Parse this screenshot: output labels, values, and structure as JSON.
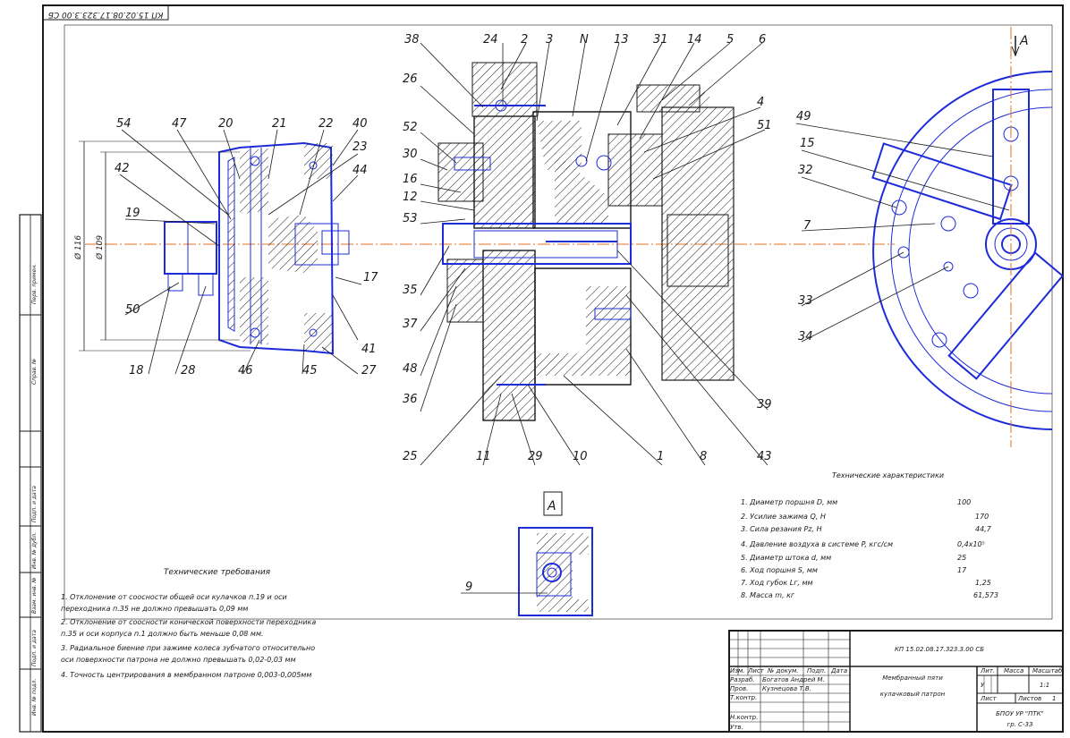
{
  "stamp_code": "КП 15.02.08.17.323.3.00 СБ",
  "side_labels": [
    "Инв. № подл.",
    "Подп. и дата",
    "Взам. инв. №",
    "Инв. № дубл.",
    "Подп. и дата",
    "Справ. №",
    "Перв. примен."
  ],
  "dimensions": {
    "d1": "Ø 116",
    "d2": "Ø 109"
  },
  "view_marker": "A",
  "section_view_label": "A",
  "callouts": {
    "c54": "54",
    "c47": "47",
    "c20": "20",
    "c21": "21",
    "c22": "22",
    "c40": "40",
    "c42": "42",
    "c23": "23",
    "c44": "44",
    "c19": "19",
    "c17": "17",
    "c50": "50",
    "c41": "41",
    "c18": "18",
    "c28": "28",
    "c46": "46",
    "c45": "45",
    "c27": "27",
    "c38": "38",
    "c24": "24",
    "c2": "2",
    "c3": "3",
    "cN": "N",
    "c13": "13",
    "c31": "31",
    "c14": "14",
    "c5": "5",
    "c6": "6",
    "c26": "26",
    "c4": "4",
    "c52": "52",
    "c51": "51",
    "c30": "30",
    "c16": "16",
    "c12": "12",
    "c53": "53",
    "c35": "35",
    "c37": "37",
    "c48": "48",
    "c36": "36",
    "c25": "25",
    "c11": "11",
    "c29": "29",
    "c10": "10",
    "c1": "1",
    "c8": "8",
    "c43": "43",
    "c39": "39",
    "c49": "49",
    "c15": "15",
    "c32": "32",
    "c7": "7",
    "c33": "33",
    "c34": "34",
    "c9": "9"
  },
  "tech_requirements": {
    "title": "Технические требования",
    "items": [
      "1. Отклонение от соосности общей оси кулачков п.19 и оси",
      "переходника п.35 не должно превышать 0,09 мм",
      "2. Отклонение от соосности конической поверхности переходника",
      "п.35 и оси корпуса п.1 должно быть меньше 0,08 мм.",
      "3. Радиальное биение при зажиме колеса зубчатого относительно",
      "оси поверхности патрона не должно превышать 0,02-0,03 мм",
      "4. Точность центрирования в мембранном патроне 0,003-0,005мм"
    ]
  },
  "tech_characteristics": {
    "title": "Технические характеристики",
    "rows": [
      {
        "label": "1. Диаметр поршня D, мм",
        "value": "100"
      },
      {
        "label": "2. Усилие зажима Q, Н",
        "value": "170"
      },
      {
        "label": "3. Сила резания Pz, Н",
        "value": "44,7"
      },
      {
        "label": "4. Давление воздуха в системе P, кгс/см",
        "value": "0,4x10⁵"
      },
      {
        "label": "5. Диаметр штока d, мм",
        "value": "25"
      },
      {
        "label": "6. Ход поршня S, мм",
        "value": "17"
      },
      {
        "label": "7. Ход губок Lг, мм",
        "value": "1,25"
      },
      {
        "label": "8. Масса m, кг",
        "value": "61,573"
      }
    ]
  },
  "title_block": {
    "doc_code": "КП 15.02.08.17.323.3.00 СБ",
    "title_line1": "Мембранный пяти",
    "title_line2": "кулачковый патрон",
    "col_lit": "Лит.",
    "col_mass": "Масса",
    "col_scale": "Масштаб",
    "lit_value": "У",
    "scale_value": "1:1",
    "sheet_label": "Лист",
    "sheets_label": "Листов",
    "sheets_value": "1",
    "org_line1": "БПОУ УР \"ПТК\"",
    "org_line2": "гр. С-33",
    "hdr_izm": "Изм.",
    "hdr_list": "Лист",
    "hdr_doc": "№ докум.",
    "hdr_sign": "Подп.",
    "hdr_date": "Дата",
    "role_developer": "Разраб.",
    "role_checker": "Пров.",
    "role_tcontrol": "Т.контр.",
    "role_ncontrol": "Н.контр.",
    "role_approved": "Утв.",
    "developer_name": "Богатов Андрей М.",
    "checker_name": "Кузнецова Т.В."
  }
}
